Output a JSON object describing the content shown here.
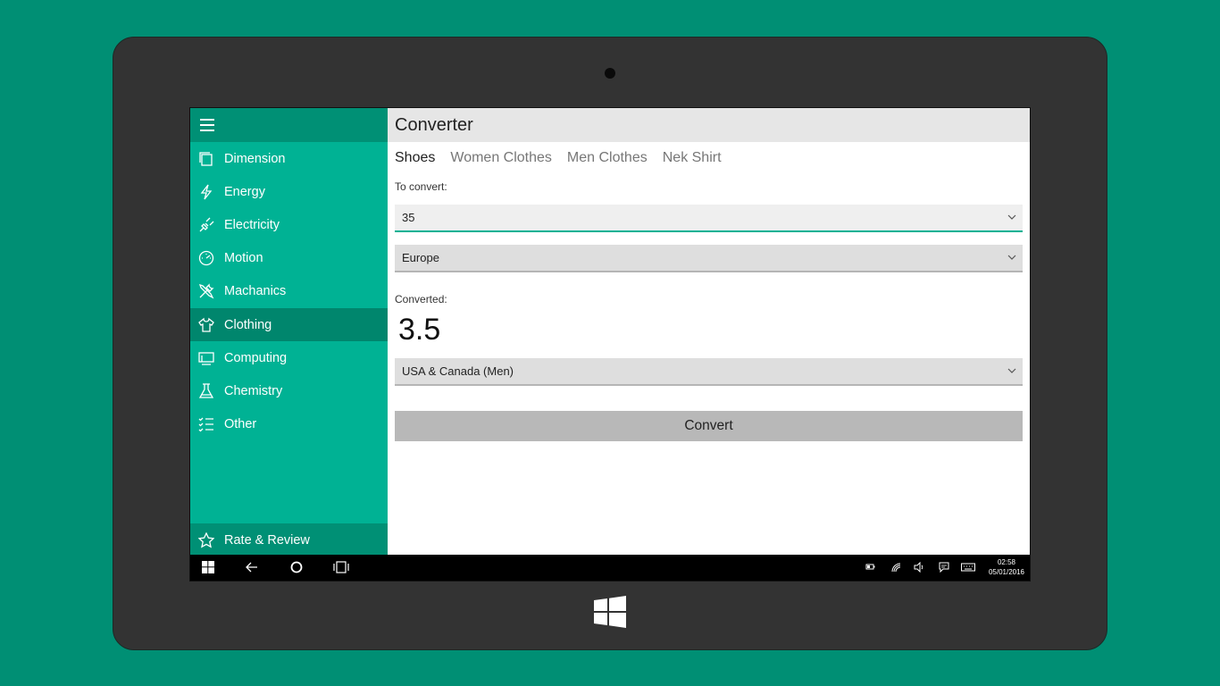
{
  "app": {
    "title": "Converter"
  },
  "sidebar": {
    "items": [
      {
        "label": "Dimension",
        "icon": "dimension-icon"
      },
      {
        "label": "Energy",
        "icon": "lightning-icon"
      },
      {
        "label": "Electricity",
        "icon": "plug-icon"
      },
      {
        "label": "Motion",
        "icon": "speedometer-icon"
      },
      {
        "label": "Machanics",
        "icon": "tools-icon"
      },
      {
        "label": "Clothing",
        "icon": "shirt-icon",
        "active": true
      },
      {
        "label": "Computing",
        "icon": "computer-icon"
      },
      {
        "label": "Chemistry",
        "icon": "flask-icon"
      },
      {
        "label": "Other",
        "icon": "checklist-icon"
      }
    ],
    "footer_label": "Rate & Review"
  },
  "tabs": [
    "Shoes",
    "Women Clothes",
    "Men Clothes",
    "Nek Shirt"
  ],
  "form": {
    "to_convert_label": "To convert:",
    "input_value": "35",
    "from_unit": "Europe",
    "converted_label": "Converted:",
    "result": "3.5",
    "to_unit": "USA & Canada (Men)",
    "convert_button": "Convert"
  },
  "taskbar": {
    "time": "02:58",
    "date": "05/01/2016"
  },
  "colors": {
    "background": "#008f74",
    "sidebar": "#00b294",
    "sidebar_active": "#00866d",
    "accent": "#00b294"
  }
}
